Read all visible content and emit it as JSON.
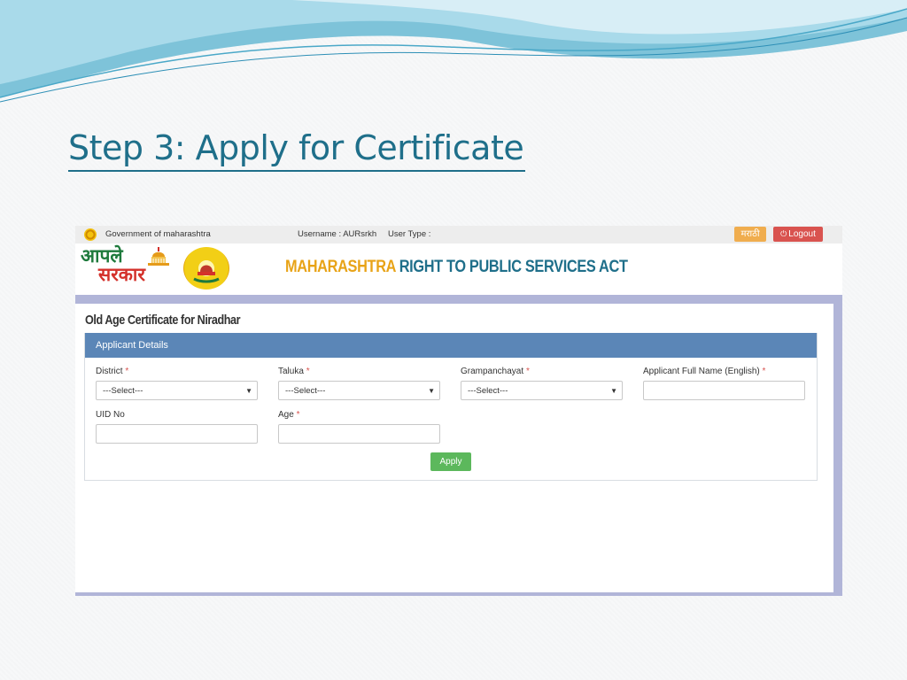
{
  "slide": {
    "title": "Step 3: Apply for Certificate"
  },
  "topbar": {
    "gov_text": "Government of maharashtra",
    "username": "Username : AURsrkh",
    "user_type": "User Type :",
    "marathi_label": "मराठी",
    "logout_label": "Logout",
    "colors": {
      "marathi": "#f0ad4e",
      "logout": "#d9534f"
    }
  },
  "header": {
    "logo_line1": "आपले",
    "logo_line2": "सरकार",
    "act_part1": "MAHARASHTRA",
    "act_part2": " RIGHT TO PUBLIC SERVICES ACT"
  },
  "form": {
    "page_title": "Old Age Certificate for Niradhar",
    "panel_title": "Applicant Details",
    "required_mark": "*",
    "district": {
      "label": "District",
      "value": "---Select---"
    },
    "taluka": {
      "label": "Taluka",
      "value": "---Select---"
    },
    "grampanchayat": {
      "label": "Grampanchayat",
      "value": "---Select---"
    },
    "applicant_name": {
      "label": "Applicant Full Name (English)",
      "value": ""
    },
    "uid": {
      "label": "UID No",
      "value": ""
    },
    "age": {
      "label": "Age",
      "value": ""
    },
    "apply_label": "Apply",
    "colors": {
      "panel_header": "#5b86b7",
      "apply": "#5cb85c"
    }
  }
}
